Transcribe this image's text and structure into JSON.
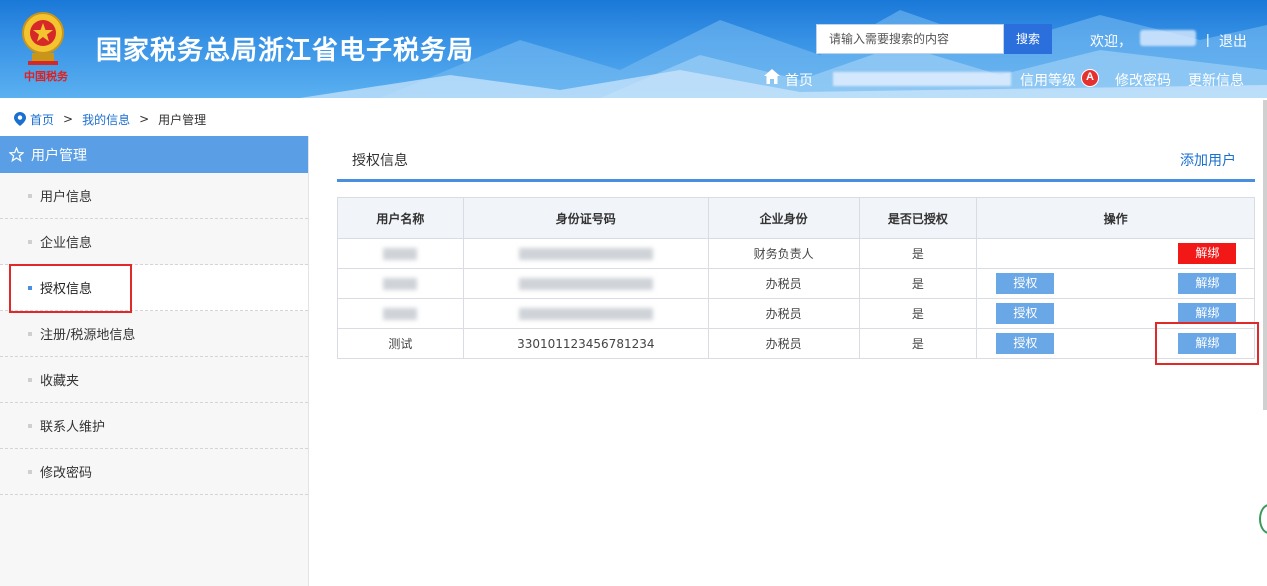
{
  "header": {
    "site_title": "国家税务总局浙江省电子税务局",
    "seal_text": "中国税务",
    "search_placeholder": "请输入需要搜索的内容",
    "search_button": "搜索",
    "welcome": "欢迎，",
    "separator": "|",
    "logout": "退出",
    "home": "首页",
    "credit_level_label": "信用等级",
    "credit_level_value": "A",
    "change_password": "修改密码",
    "update_info": "更新信息"
  },
  "breadcrumb": {
    "items": [
      "首页",
      "我的信息",
      "用户管理"
    ],
    "separator": ">"
  },
  "sidebar": {
    "title": "用户管理",
    "items": [
      {
        "label": "用户信息"
      },
      {
        "label": "企业信息"
      },
      {
        "label": "授权信息",
        "active": true
      },
      {
        "label": "注册/税源地信息"
      },
      {
        "label": "收藏夹"
      },
      {
        "label": "联系人维护"
      },
      {
        "label": "修改密码"
      }
    ]
  },
  "main": {
    "section_title": "授权信息",
    "add_user": "添加用户",
    "table": {
      "columns": [
        "用户名称",
        "身份证号码",
        "企业身份",
        "是否已授权",
        "操作"
      ],
      "rows": [
        {
          "name": "",
          "id_number": "",
          "role": "财务负责人",
          "authorized": "是",
          "auth_button": "",
          "unbind_button": "解绑"
        },
        {
          "name": "",
          "id_number": "",
          "role": "办税员",
          "authorized": "是",
          "auth_button": "授权",
          "unbind_button": "解绑"
        },
        {
          "name": "",
          "id_number": "",
          "role": "办税员",
          "authorized": "是",
          "auth_button": "授权",
          "unbind_button": "解绑"
        },
        {
          "name": "测试",
          "id_number": "330101123456781234",
          "role": "办税员",
          "authorized": "是",
          "auth_button": "授权",
          "unbind_button": "解绑"
        }
      ]
    }
  },
  "colors": {
    "header_blue": "#1a78d8",
    "sidebar_head": "#5a9fe6",
    "button_blue": "#6aa7e6",
    "button_red": "#f21818",
    "highlight_red": "#e02a2a"
  }
}
